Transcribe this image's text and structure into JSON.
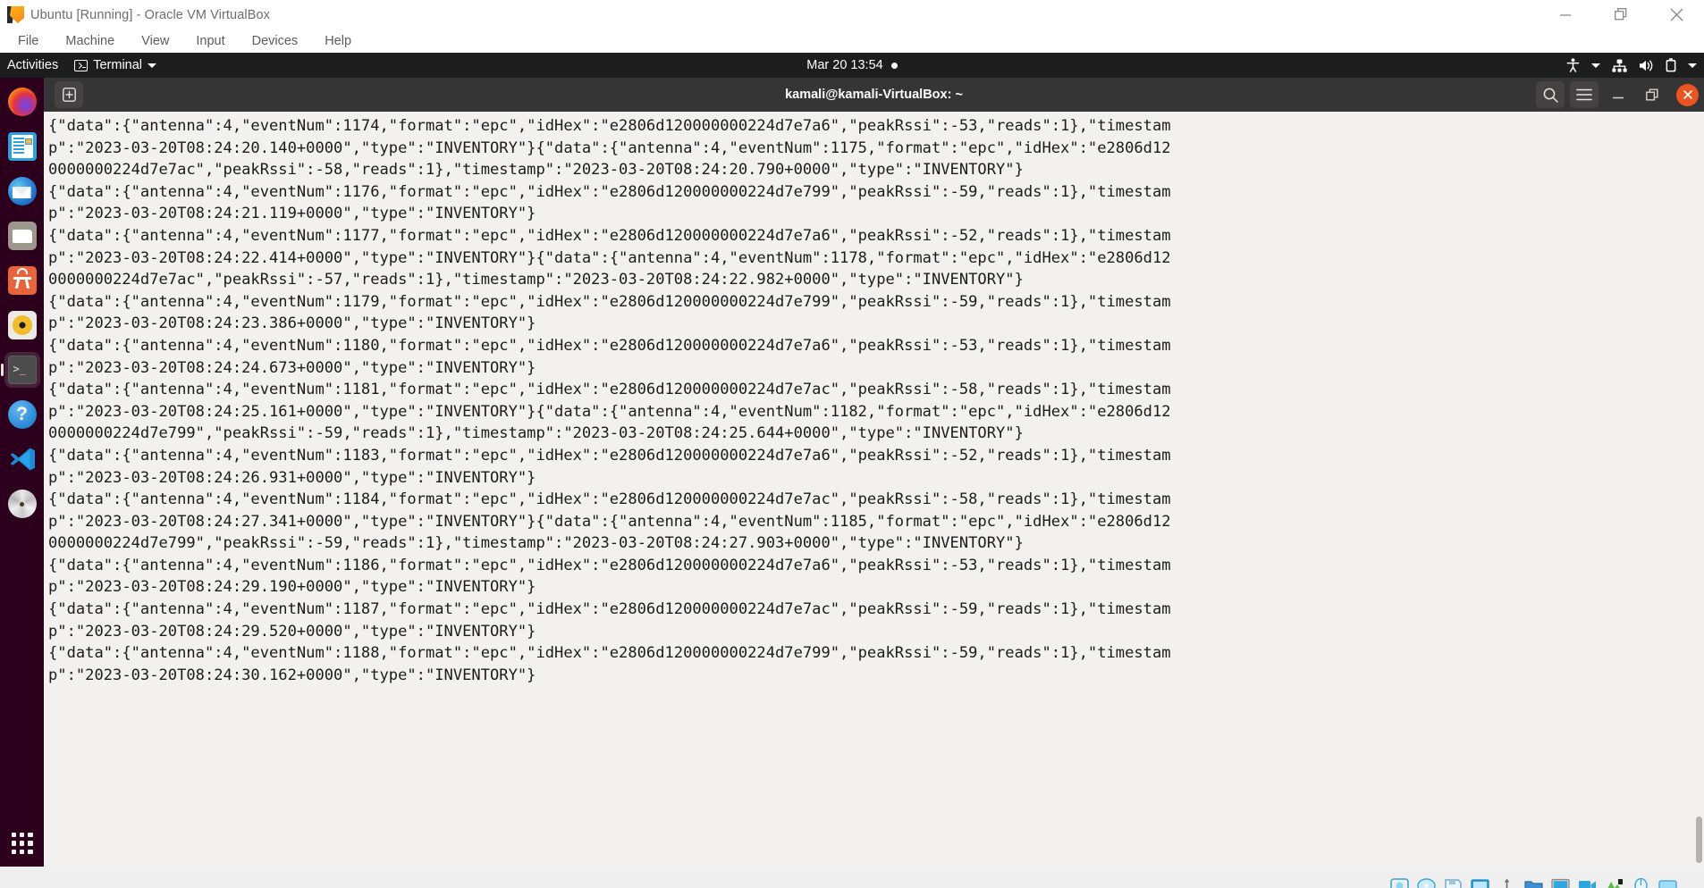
{
  "vbox": {
    "title": "Ubuntu [Running] - Oracle VM VirtualBox",
    "app_icon": "virtualbox-icon",
    "menus": [
      "File",
      "Machine",
      "View",
      "Input",
      "Devices",
      "Help"
    ],
    "window_controls": [
      {
        "name": "minimize-button",
        "glyph": "minimize-icon"
      },
      {
        "name": "restore-button",
        "glyph": "restore-icon"
      },
      {
        "name": "close-button",
        "glyph": "close-icon"
      }
    ],
    "status_icons": [
      "hard-disk-icon",
      "optical-disk-icon",
      "floppy-icon",
      "network-icon",
      "usb-icon",
      "shared-folder-icon",
      "display-icon",
      "recording-icon",
      "features-icon",
      "mouse-icon",
      "keyboard-icon"
    ]
  },
  "gnome": {
    "activities": "Activities",
    "app_menu_label": "Terminal",
    "app_menu_icon": "terminal-icon",
    "clock": "Mar 20  13:54",
    "notification_dot": true,
    "tray_icons": [
      "accessibility-icon",
      "chevron-down-icon",
      "network-wired-icon",
      "volume-icon",
      "battery-icon",
      "chevron-down-icon"
    ]
  },
  "dock": {
    "items": [
      {
        "name": "firefox",
        "label": "Firefox",
        "running": false
      },
      {
        "name": "libreoffice-writer",
        "label": "LibreOffice Writer",
        "running": false
      },
      {
        "name": "thunderbird",
        "label": "Thunderbird Mail",
        "running": false
      },
      {
        "name": "files",
        "label": "Files",
        "running": false
      },
      {
        "name": "ubuntu-software",
        "label": "Ubuntu Software",
        "running": false
      },
      {
        "name": "rhythmbox",
        "label": "Rhythmbox",
        "running": false
      },
      {
        "name": "terminal",
        "label": "Terminal",
        "running": true
      },
      {
        "name": "help",
        "label": "Help",
        "running": false
      },
      {
        "name": "vscode",
        "label": "Visual Studio Code",
        "running": false
      },
      {
        "name": "disc",
        "label": "CD/DVD Drive",
        "running": false
      }
    ],
    "show_apps": "show-applications-grid"
  },
  "terminal": {
    "title": "kamali@kamali-VirtualBox: ~",
    "new_tab_icon": "new-tab-icon",
    "buttons": [
      {
        "name": "search-button",
        "icon": "search-icon"
      },
      {
        "name": "menu-button",
        "icon": "hamburger-menu-icon"
      },
      {
        "name": "minimize-button",
        "icon": "minimize-icon"
      },
      {
        "name": "maximize-button",
        "icon": "maximize-icon"
      },
      {
        "name": "close-button",
        "icon": "close-icon"
      }
    ],
    "colors": {
      "background": "#f2f1f0",
      "foreground": "#1c1c1c",
      "header": "#353535",
      "close_accent": "#e95420"
    },
    "lines": [
      "{\"data\":{\"antenna\":4,\"eventNum\":1174,\"format\":\"epc\",\"idHex\":\"e2806d120000000224d7e7a6\",\"peakRssi\":-53,\"reads\":1},\"timestam",
      "p\":\"2023-03-20T08:24:20.140+0000\",\"type\":\"INVENTORY\"}{\"data\":{\"antenna\":4,\"eventNum\":1175,\"format\":\"epc\",\"idHex\":\"e2806d12",
      "0000000224d7e7ac\",\"peakRssi\":-58,\"reads\":1},\"timestamp\":\"2023-03-20T08:24:20.790+0000\",\"type\":\"INVENTORY\"}",
      "{\"data\":{\"antenna\":4,\"eventNum\":1176,\"format\":\"epc\",\"idHex\":\"e2806d120000000224d7e799\",\"peakRssi\":-59,\"reads\":1},\"timestam",
      "p\":\"2023-03-20T08:24:21.119+0000\",\"type\":\"INVENTORY\"}",
      "{\"data\":{\"antenna\":4,\"eventNum\":1177,\"format\":\"epc\",\"idHex\":\"e2806d120000000224d7e7a6\",\"peakRssi\":-52,\"reads\":1},\"timestam",
      "p\":\"2023-03-20T08:24:22.414+0000\",\"type\":\"INVENTORY\"}{\"data\":{\"antenna\":4,\"eventNum\":1178,\"format\":\"epc\",\"idHex\":\"e2806d12",
      "0000000224d7e7ac\",\"peakRssi\":-57,\"reads\":1},\"timestamp\":\"2023-03-20T08:24:22.982+0000\",\"type\":\"INVENTORY\"}",
      "{\"data\":{\"antenna\":4,\"eventNum\":1179,\"format\":\"epc\",\"idHex\":\"e2806d120000000224d7e799\",\"peakRssi\":-59,\"reads\":1},\"timestam",
      "p\":\"2023-03-20T08:24:23.386+0000\",\"type\":\"INVENTORY\"}",
      "{\"data\":{\"antenna\":4,\"eventNum\":1180,\"format\":\"epc\",\"idHex\":\"e2806d120000000224d7e7a6\",\"peakRssi\":-53,\"reads\":1},\"timestam",
      "p\":\"2023-03-20T08:24:24.673+0000\",\"type\":\"INVENTORY\"}",
      "{\"data\":{\"antenna\":4,\"eventNum\":1181,\"format\":\"epc\",\"idHex\":\"e2806d120000000224d7e7ac\",\"peakRssi\":-58,\"reads\":1},\"timestam",
      "p\":\"2023-03-20T08:24:25.161+0000\",\"type\":\"INVENTORY\"}{\"data\":{\"antenna\":4,\"eventNum\":1182,\"format\":\"epc\",\"idHex\":\"e2806d12",
      "0000000224d7e799\",\"peakRssi\":-59,\"reads\":1},\"timestamp\":\"2023-03-20T08:24:25.644+0000\",\"type\":\"INVENTORY\"}",
      "{\"data\":{\"antenna\":4,\"eventNum\":1183,\"format\":\"epc\",\"idHex\":\"e2806d120000000224d7e7a6\",\"peakRssi\":-52,\"reads\":1},\"timestam",
      "p\":\"2023-03-20T08:24:26.931+0000\",\"type\":\"INVENTORY\"}",
      "{\"data\":{\"antenna\":4,\"eventNum\":1184,\"format\":\"epc\",\"idHex\":\"e2806d120000000224d7e7ac\",\"peakRssi\":-58,\"reads\":1},\"timestam",
      "p\":\"2023-03-20T08:24:27.341+0000\",\"type\":\"INVENTORY\"}{\"data\":{\"antenna\":4,\"eventNum\":1185,\"format\":\"epc\",\"idHex\":\"e2806d12",
      "0000000224d7e799\",\"peakRssi\":-59,\"reads\":1},\"timestamp\":\"2023-03-20T08:24:27.903+0000\",\"type\":\"INVENTORY\"}",
      "{\"data\":{\"antenna\":4,\"eventNum\":1186,\"format\":\"epc\",\"idHex\":\"e2806d120000000224d7e7a6\",\"peakRssi\":-53,\"reads\":1},\"timestam",
      "p\":\"2023-03-20T08:24:29.190+0000\",\"type\":\"INVENTORY\"}",
      "{\"data\":{\"antenna\":4,\"eventNum\":1187,\"format\":\"epc\",\"idHex\":\"e2806d120000000224d7e7ac\",\"peakRssi\":-59,\"reads\":1},\"timestam",
      "p\":\"2023-03-20T08:24:29.520+0000\",\"type\":\"INVENTORY\"}",
      "{\"data\":{\"antenna\":4,\"eventNum\":1188,\"format\":\"epc\",\"idHex\":\"e2806d120000000224d7e799\",\"peakRssi\":-59,\"reads\":1},\"timestam",
      "p\":\"2023-03-20T08:24:30.162+0000\",\"type\":\"INVENTORY\"}"
    ]
  }
}
